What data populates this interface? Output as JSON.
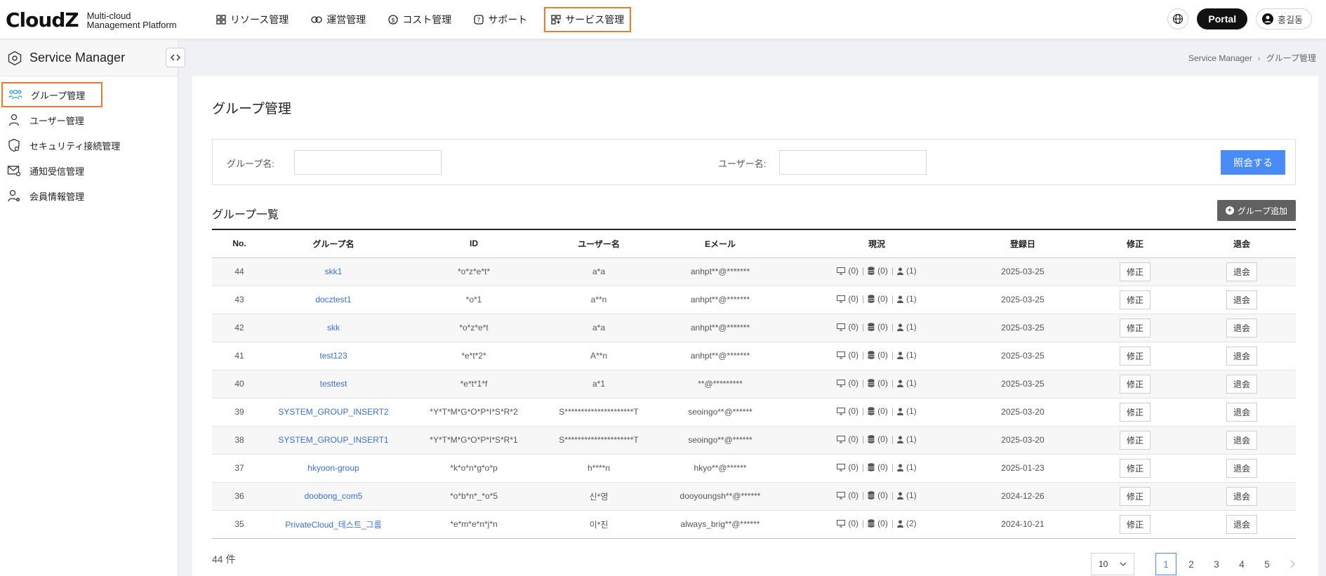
{
  "header": {
    "logo": "CloudZ",
    "logo_sub_1": "Multi-cloud",
    "logo_sub_2": "Management Platform",
    "nav": [
      {
        "label": "リソース管理",
        "icon": "grid-icon"
      },
      {
        "label": "運営管理",
        "icon": "link-icon"
      },
      {
        "label": "コスト管理",
        "icon": "dollar-icon"
      },
      {
        "label": "サポート",
        "icon": "help-icon"
      },
      {
        "label": "サービス管理",
        "icon": "apps-add-icon",
        "active": true
      }
    ],
    "portal_label": "Portal",
    "user_name": "홍길동"
  },
  "sidebar": {
    "title": "Service Manager",
    "items": [
      {
        "label": "グループ管理",
        "icon": "group-icon",
        "active": true
      },
      {
        "label": "ユーザー管理",
        "icon": "user-icon"
      },
      {
        "label": "セキュリティ接続管理",
        "icon": "shield-icon"
      },
      {
        "label": "通知受信管理",
        "icon": "mail-icon"
      },
      {
        "label": "会員情報管理",
        "icon": "user-settings-icon"
      }
    ]
  },
  "breadcrumb": {
    "root": "Service Manager",
    "current": "グループ管理"
  },
  "main": {
    "title": "グループ管理",
    "search": {
      "group_label": "グループ名:",
      "group_value": "",
      "user_label": "ユーザー名:",
      "user_value": "",
      "button": "照会する"
    },
    "list_title": "グループ一覧",
    "add_button": "グループ追加",
    "columns": [
      "No.",
      "グループ名",
      "ID",
      "ユーザー名",
      "Eメール",
      "現況",
      "登録日",
      "修正",
      "退会"
    ],
    "rows": [
      {
        "no": "44",
        "group": "skk1",
        "id": "*o*z*e*t*",
        "user": "a*a",
        "email": "anhpt**@*******",
        "vm": "(0)",
        "db": "(0)",
        "users": "(1)",
        "date": "2025-03-25"
      },
      {
        "no": "43",
        "group": "docztest1",
        "id": "*o*1",
        "user": "a**n",
        "email": "anhpt**@*******",
        "vm": "(0)",
        "db": "(0)",
        "users": "(1)",
        "date": "2025-03-25"
      },
      {
        "no": "42",
        "group": "skk",
        "id": "*o*z*e*t",
        "user": "a*a",
        "email": "anhpt**@*******",
        "vm": "(0)",
        "db": "(0)",
        "users": "(1)",
        "date": "2025-03-25"
      },
      {
        "no": "41",
        "group": "test123",
        "id": "*e*t*2*",
        "user": "A**n",
        "email": "anhpt**@*******",
        "vm": "(0)",
        "db": "(0)",
        "users": "(1)",
        "date": "2025-03-25"
      },
      {
        "no": "40",
        "group": "testtest",
        "id": "*e*t*1*f",
        "user": "a*1",
        "email": "**@*********",
        "vm": "(0)",
        "db": "(0)",
        "users": "(1)",
        "date": "2025-03-25"
      },
      {
        "no": "39",
        "group": "SYSTEM_GROUP_INSERT2",
        "id": "*Y*T*M*G*O*P*I*S*R*2",
        "user": "S*********************T",
        "email": "seoingo**@******",
        "vm": "(0)",
        "db": "(0)",
        "users": "(1)",
        "date": "2025-03-20"
      },
      {
        "no": "38",
        "group": "SYSTEM_GROUP_INSERT1",
        "id": "*Y*T*M*G*O*P*I*S*R*1",
        "user": "S*********************T",
        "email": "seoingo**@******",
        "vm": "(0)",
        "db": "(0)",
        "users": "(1)",
        "date": "2025-03-20"
      },
      {
        "no": "37",
        "group": "hkyoon-group",
        "id": "*k*o*n*g*o*p",
        "user": "h****n",
        "email": "hkyo**@******",
        "vm": "(0)",
        "db": "(0)",
        "users": "(1)",
        "date": "2025-01-23"
      },
      {
        "no": "36",
        "group": "doobong_com5",
        "id": "*o*b*n*_*o*5",
        "user": "신*영",
        "email": "dooyoungsh**@******",
        "vm": "(0)",
        "db": "(0)",
        "users": "(1)",
        "date": "2024-12-26"
      },
      {
        "no": "35",
        "group": "PrivateCloud_테스트_그룹",
        "id": "*e*m*e*n*j*n",
        "user": "이*진",
        "email": "always_brig**@******",
        "vm": "(0)",
        "db": "(0)",
        "users": "(2)",
        "date": "2024-10-21"
      }
    ],
    "edit_label": "修正",
    "withdraw_label": "退会",
    "total": "44 件",
    "page_size": "10",
    "pages": [
      "1",
      "2",
      "3",
      "4",
      "5"
    ],
    "current_page": "1"
  }
}
